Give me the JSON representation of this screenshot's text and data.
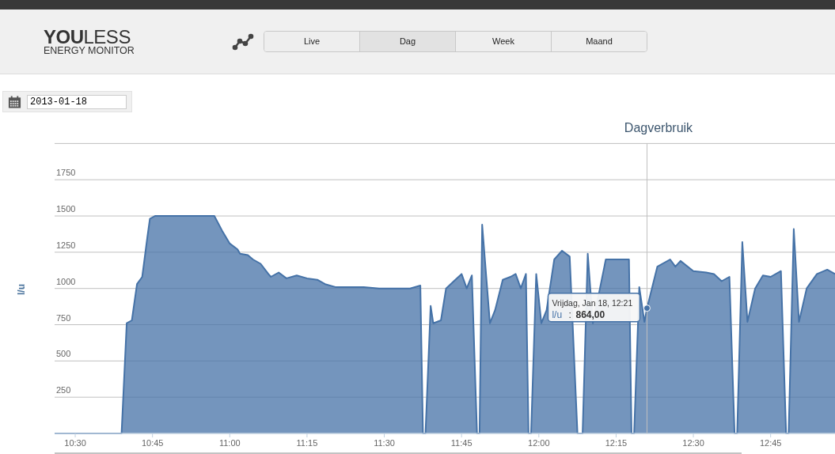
{
  "header": {
    "logo_bold": "YOU",
    "logo_light": "LESS",
    "logo_subtitle": "ENERGY MONITOR"
  },
  "tabs": [
    {
      "label": "Live",
      "selected": false
    },
    {
      "label": "Dag",
      "selected": true
    },
    {
      "label": "Week",
      "selected": false
    },
    {
      "label": "Maand",
      "selected": false
    }
  ],
  "date_field": {
    "value": "2013-01-18"
  },
  "chart": {
    "chart_data": {
      "type": "area",
      "title": "Dagverbruik",
      "ylabel": "l/u",
      "x": [
        10.4333,
        10.65,
        10.6667,
        10.6833,
        10.7,
        10.7167,
        10.7333,
        10.7417,
        10.7583,
        10.95,
        10.975,
        11,
        11.025,
        11.0333,
        11.0583,
        11.075,
        11.1,
        11.125,
        11.1333,
        11.1583,
        11.1833,
        11.2167,
        11.25,
        11.2833,
        11.3083,
        11.3417,
        11.3833,
        11.4333,
        11.4833,
        11.5333,
        11.5833,
        11.6167,
        11.625,
        11.6333,
        11.65,
        11.6583,
        11.6833,
        11.7,
        11.725,
        11.75,
        11.7667,
        11.7833,
        11.8,
        11.8083,
        11.8167,
        11.8417,
        11.8583,
        11.8833,
        11.9083,
        11.925,
        11.9417,
        11.9583,
        11.9667,
        11.975,
        11.9917,
        12.0083,
        12.025,
        12.05,
        12.075,
        12.1,
        12.125,
        12.1417,
        12.1583,
        12.175,
        12.2167,
        12.2917,
        12.3,
        12.3083,
        12.325,
        12.3417,
        12.35,
        12.3833,
        12.425,
        12.4417,
        12.4583,
        12.5,
        12.5417,
        12.5667,
        12.5917,
        12.6167,
        12.6333,
        12.6417,
        12.6583,
        12.675,
        12.7,
        12.725,
        12.75,
        12.7833,
        12.8,
        12.8083,
        12.825,
        12.8417,
        12.8667,
        12.9,
        12.9333,
        12.9583
      ],
      "series": [
        {
          "name": "l/u",
          "color": "#4572a7",
          "values": [
            0,
            0,
            760,
            780,
            1030,
            1080,
            1350,
            1480,
            1500,
            1500,
            1400,
            1310,
            1270,
            1240,
            1230,
            1200,
            1170,
            1100,
            1080,
            1110,
            1070,
            1090,
            1070,
            1060,
            1030,
            1010,
            1010,
            1010,
            1000,
            1000,
            1000,
            1020,
            0,
            0,
            880,
            760,
            780,
            1000,
            1050,
            1100,
            1000,
            1090,
            0,
            0,
            1440,
            760,
            850,
            1060,
            1080,
            1100,
            1000,
            1100,
            0,
            0,
            1100,
            760,
            850,
            1200,
            1260,
            1220,
            0,
            0,
            1240,
            760,
            1200,
            1200,
            0,
            0,
            1010,
            770,
            864,
            1150,
            1200,
            1150,
            1190,
            1120,
            1110,
            1100,
            1050,
            1080,
            0,
            0,
            1320,
            770,
            1000,
            1090,
            1080,
            1120,
            0,
            0,
            1410,
            770,
            1000,
            1100,
            1130,
            1100
          ]
        }
      ],
      "xlim": [
        10.4333,
        12.9583
      ],
      "ylim": [
        0,
        2000
      ],
      "grid": true,
      "yticks": [
        {
          "value": 250,
          "label": "250"
        },
        {
          "value": 500,
          "label": "500"
        },
        {
          "value": 750,
          "label": "750"
        },
        {
          "value": 1000,
          "label": "1000"
        },
        {
          "value": 1250,
          "label": "1250"
        },
        {
          "value": 1500,
          "label": "1500"
        },
        {
          "value": 1750,
          "label": "1750"
        }
      ],
      "xticks": [
        {
          "value": 10.5,
          "label": "10:30"
        },
        {
          "value": 10.75,
          "label": "10:45"
        },
        {
          "value": 11,
          "label": "11:00"
        },
        {
          "value": 11.25,
          "label": "11:15"
        },
        {
          "value": 11.5,
          "label": "11:30"
        },
        {
          "value": 11.75,
          "label": "11:45"
        },
        {
          "value": 12,
          "label": "12:00"
        },
        {
          "value": 12.25,
          "label": "12:15"
        },
        {
          "value": 12.5,
          "label": "12:30"
        },
        {
          "value": 12.75,
          "label": "12:45"
        }
      ],
      "annotations": [
        {
          "x": 12.35,
          "y": 864,
          "text": "Vrijdag, Jan 18, 12:21"
        }
      ]
    },
    "tooltip": {
      "separator": ":",
      "value": "864,00"
    }
  }
}
